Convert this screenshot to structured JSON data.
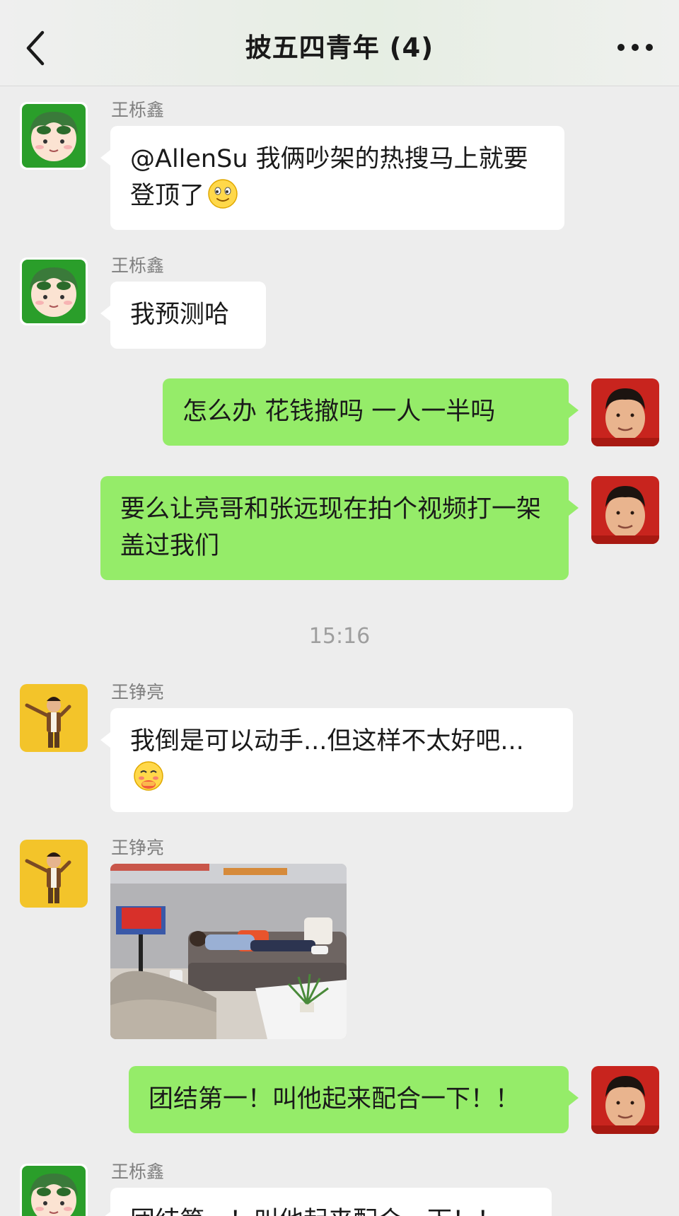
{
  "header": {
    "title": "披五四青年 (4)",
    "back_icon": "chevron-left-icon",
    "more_icon": "ellipsis-icon"
  },
  "colors": {
    "background": "#ededed",
    "self_bubble": "#95ec69",
    "other_bubble": "#ffffff",
    "sender_text": "#7f7f7f"
  },
  "messages": [
    {
      "side": "left",
      "sender": "王栎鑫",
      "avatar": "cartoon-green-avatar",
      "text": "@AllenSu 我俩吵架的热搜马上就要登顶了",
      "emoji": "smile-emoji"
    },
    {
      "side": "left",
      "sender": "王栎鑫",
      "avatar": "cartoon-green-avatar",
      "text": "我预测哈"
    },
    {
      "side": "right",
      "avatar": "self-avatar",
      "text": "怎么办 花钱撤吗 一人一半吗"
    },
    {
      "side": "right",
      "avatar": "self-avatar",
      "text": "要么让亮哥和张远现在拍个视频打一架 盖过我们"
    },
    {
      "type": "timestamp",
      "text": "15:16"
    },
    {
      "side": "left",
      "sender": "王铮亮",
      "avatar": "yellow-performer-avatar",
      "text": "我倒是可以动手...但这样不太好吧...",
      "emoji": "shy-emoji"
    },
    {
      "side": "left",
      "sender": "王铮亮",
      "avatar": "yellow-performer-avatar",
      "type": "image",
      "image": "photo-man-sleeping-on-sofa"
    },
    {
      "side": "right",
      "avatar": "self-avatar",
      "text": "团结第一！叫他起来配合一下！！"
    },
    {
      "side": "left",
      "sender": "王栎鑫",
      "avatar": "cartoon-green-avatar",
      "text": "团结第一！叫他起来配合一下！！"
    }
  ]
}
